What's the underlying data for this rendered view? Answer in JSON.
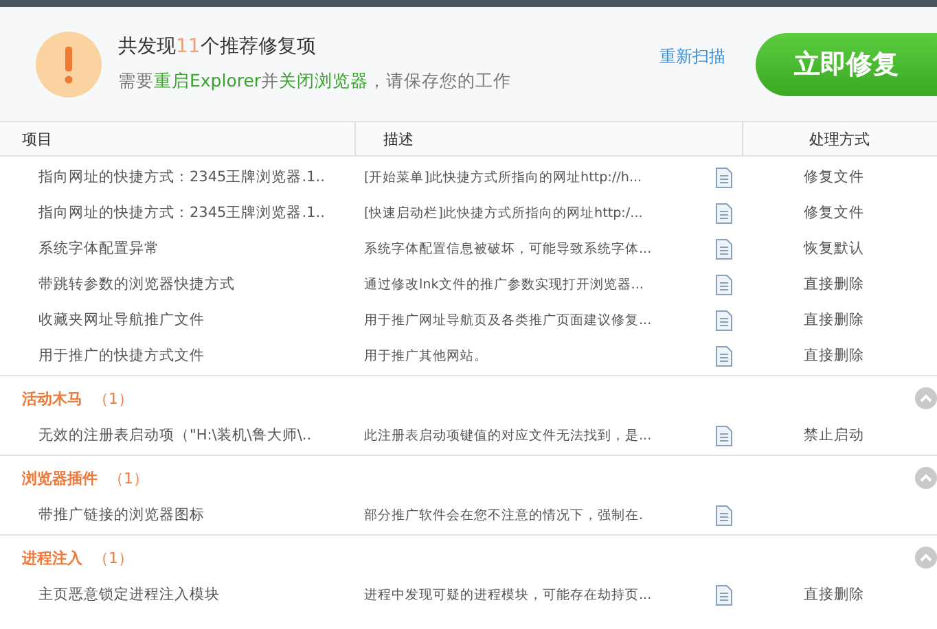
{
  "header": {
    "title_prefix": "共发现",
    "count": "11",
    "title_suffix": "个推荐修复项",
    "note": "需要**重启Explorer**并**关闭浏览器**，请保存您的工作",
    "rescan_link": "重新扫描",
    "fix_button": "立即修复"
  },
  "columns": [
    "项目",
    "描述",
    "处理方式"
  ],
  "groups": [
    {
      "items": [
        {
          "name": "指向网址的快捷方式：2345王牌浏览器.1..",
          "description": "[开始菜单]此快捷方式所指向的网址http://h...",
          "action": "修复文件"
        },
        {
          "name": "指向网址的快捷方式：2345王牌浏览器.1..",
          "description": "[快速启动栏]此快捷方式所指向的网址http:/...",
          "action": "修复文件"
        },
        {
          "name": "系统字体配置异常",
          "description": "系统字体配置信息被破坏，可能导致系统字体...",
          "action": "恢复默认"
        },
        {
          "name": "带跳转参数的浏览器快捷方式",
          "description": "通过修改lnk文件的推广参数实现打开浏览器...",
          "action": "直接删除"
        },
        {
          "name": "收藏夹网址导航推广文件",
          "description": "用于推广网址导航页及各类推广页面建议修复...",
          "action": "直接删除"
        },
        {
          "name": "用于推广的快捷方式文件",
          "description": "用于推广其他网站。",
          "action": "直接删除"
        }
      ]
    },
    {
      "title": "活动木马",
      "count": "（1）",
      "expanded": true,
      "items": [
        {
          "name": "无效的注册表启动项（\"H:\\装机\\鲁大师\\..",
          "description": "此注册表启动项键值的对应文件无法找到，是...",
          "action": "禁止启动"
        }
      ]
    },
    {
      "title": "浏览器插件",
      "count": "（1）",
      "expanded": true,
      "items": [
        {
          "name": "带推广链接的浏览器图标",
          "description": "部分推广软件会在您不注意的情况下，强制在."
        }
      ]
    },
    {
      "title": "进程注入",
      "count": "（1）",
      "expanded": true,
      "items": [
        {
          "name": "主页恶意锁定进程注入模块",
          "description": "进程中发现可疑的进程模块，可能存在劫持页...",
          "action": "直接删除"
        }
      ]
    }
  ]
}
